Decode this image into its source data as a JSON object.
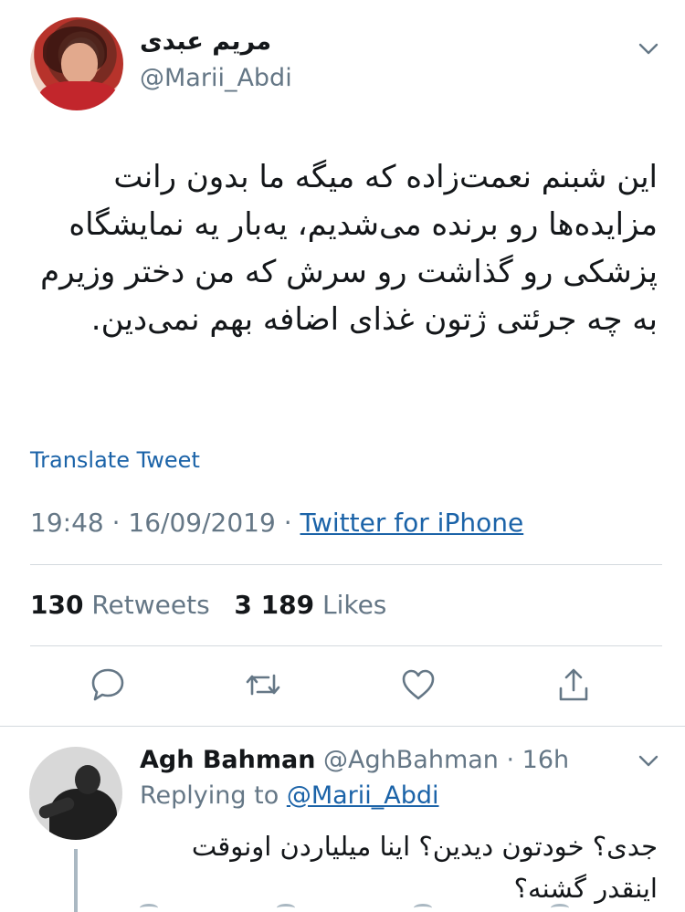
{
  "tweet": {
    "author_name": "مریم عبدی",
    "handle": "@Marii_Abdi",
    "text_lines": [
      "این شبنم نعمت‌زاده که میگه ما بدون رانت",
      "مزایده‌ها رو برنده می‌شدیم، یه‌بار یه نمایشگاه",
      "پزشکی رو گذاشت رو سرش که من دختر وزیرم",
      "به چه جرئتی ژتون غذای اضافه بهم نمی‌دین."
    ],
    "translate_label": "Translate Tweet",
    "time": "19:48",
    "date": "16/09/2019",
    "source": "Twitter for iPhone",
    "retweets_count": "130",
    "retweets_label": "Retweets",
    "likes_count": "3 189",
    "likes_label": "Likes"
  },
  "reply": {
    "author_name": "Agh Bahman",
    "handle": "@AghBahman",
    "age": "16h",
    "replying_prefix": "Replying to",
    "replying_to": "@Marii_Abdi",
    "text_lines": [
      "جدی؟ خودتون دیدین؟ اینا میلیاردن اونوقت",
      "اینقدر گشنه؟"
    ]
  },
  "colors": {
    "text": "#14171a",
    "secondary": "#657786",
    "link": "#1b63a8",
    "divider": "#d4d9de",
    "icon": "#657786"
  },
  "icons": [
    "chevron-down-icon",
    "reply-icon",
    "retweet-icon",
    "like-icon",
    "share-icon"
  ]
}
